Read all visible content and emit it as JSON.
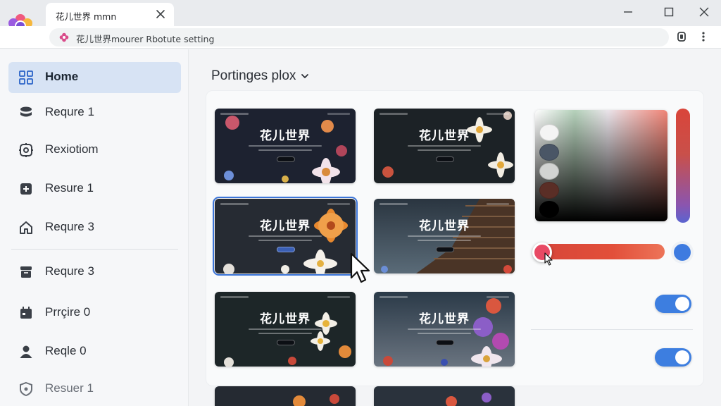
{
  "window": {
    "tab_title": "花儿世界 mmn"
  },
  "address_bar": {
    "url_text": "花儿世界mourer Rbotute setting"
  },
  "sidebar": {
    "items": [
      {
        "label": "Home",
        "icon": "grid-icon",
        "active": true
      },
      {
        "label": "Requre 1",
        "icon": "stack-icon"
      },
      {
        "label": "Rexiotiom",
        "icon": "gear-icon"
      },
      {
        "label": "Resure 1",
        "icon": "plus-square-icon"
      },
      {
        "label": "Requre 3",
        "icon": "house-icon"
      },
      {
        "label": "Requre 3",
        "icon": "archive-icon"
      },
      {
        "label": "Prrçire 0",
        "icon": "calendar-icon"
      },
      {
        "label": "Reqle 0",
        "icon": "user-icon"
      },
      {
        "label": "Resuer 1",
        "icon": "shield-icon"
      }
    ]
  },
  "main": {
    "section_title": "Portinges plox",
    "thumbnails": [
      {
        "title": "花儿世界",
        "theme": "dusk-pink"
      },
      {
        "title": "花儿世界",
        "theme": "daisy"
      },
      {
        "title": "花儿世界",
        "theme": "orange-lily",
        "selected": true
      },
      {
        "title": "花儿世界",
        "theme": "pagoda"
      },
      {
        "title": "花儿世界",
        "theme": "wild-daisy"
      },
      {
        "title": "花儿世界",
        "theme": "violet"
      }
    ]
  },
  "color_picker": {
    "swatches": [
      "#f4f4f4",
      "#4a5666",
      "#d2d4d2",
      "#5a2e26",
      "#000000"
    ],
    "selected_color": "#e84a64",
    "accent_color": "#3e7be0"
  },
  "toggles": [
    {
      "name": "toggle-1",
      "on": true
    },
    {
      "name": "toggle-2",
      "on": true
    }
  ]
}
